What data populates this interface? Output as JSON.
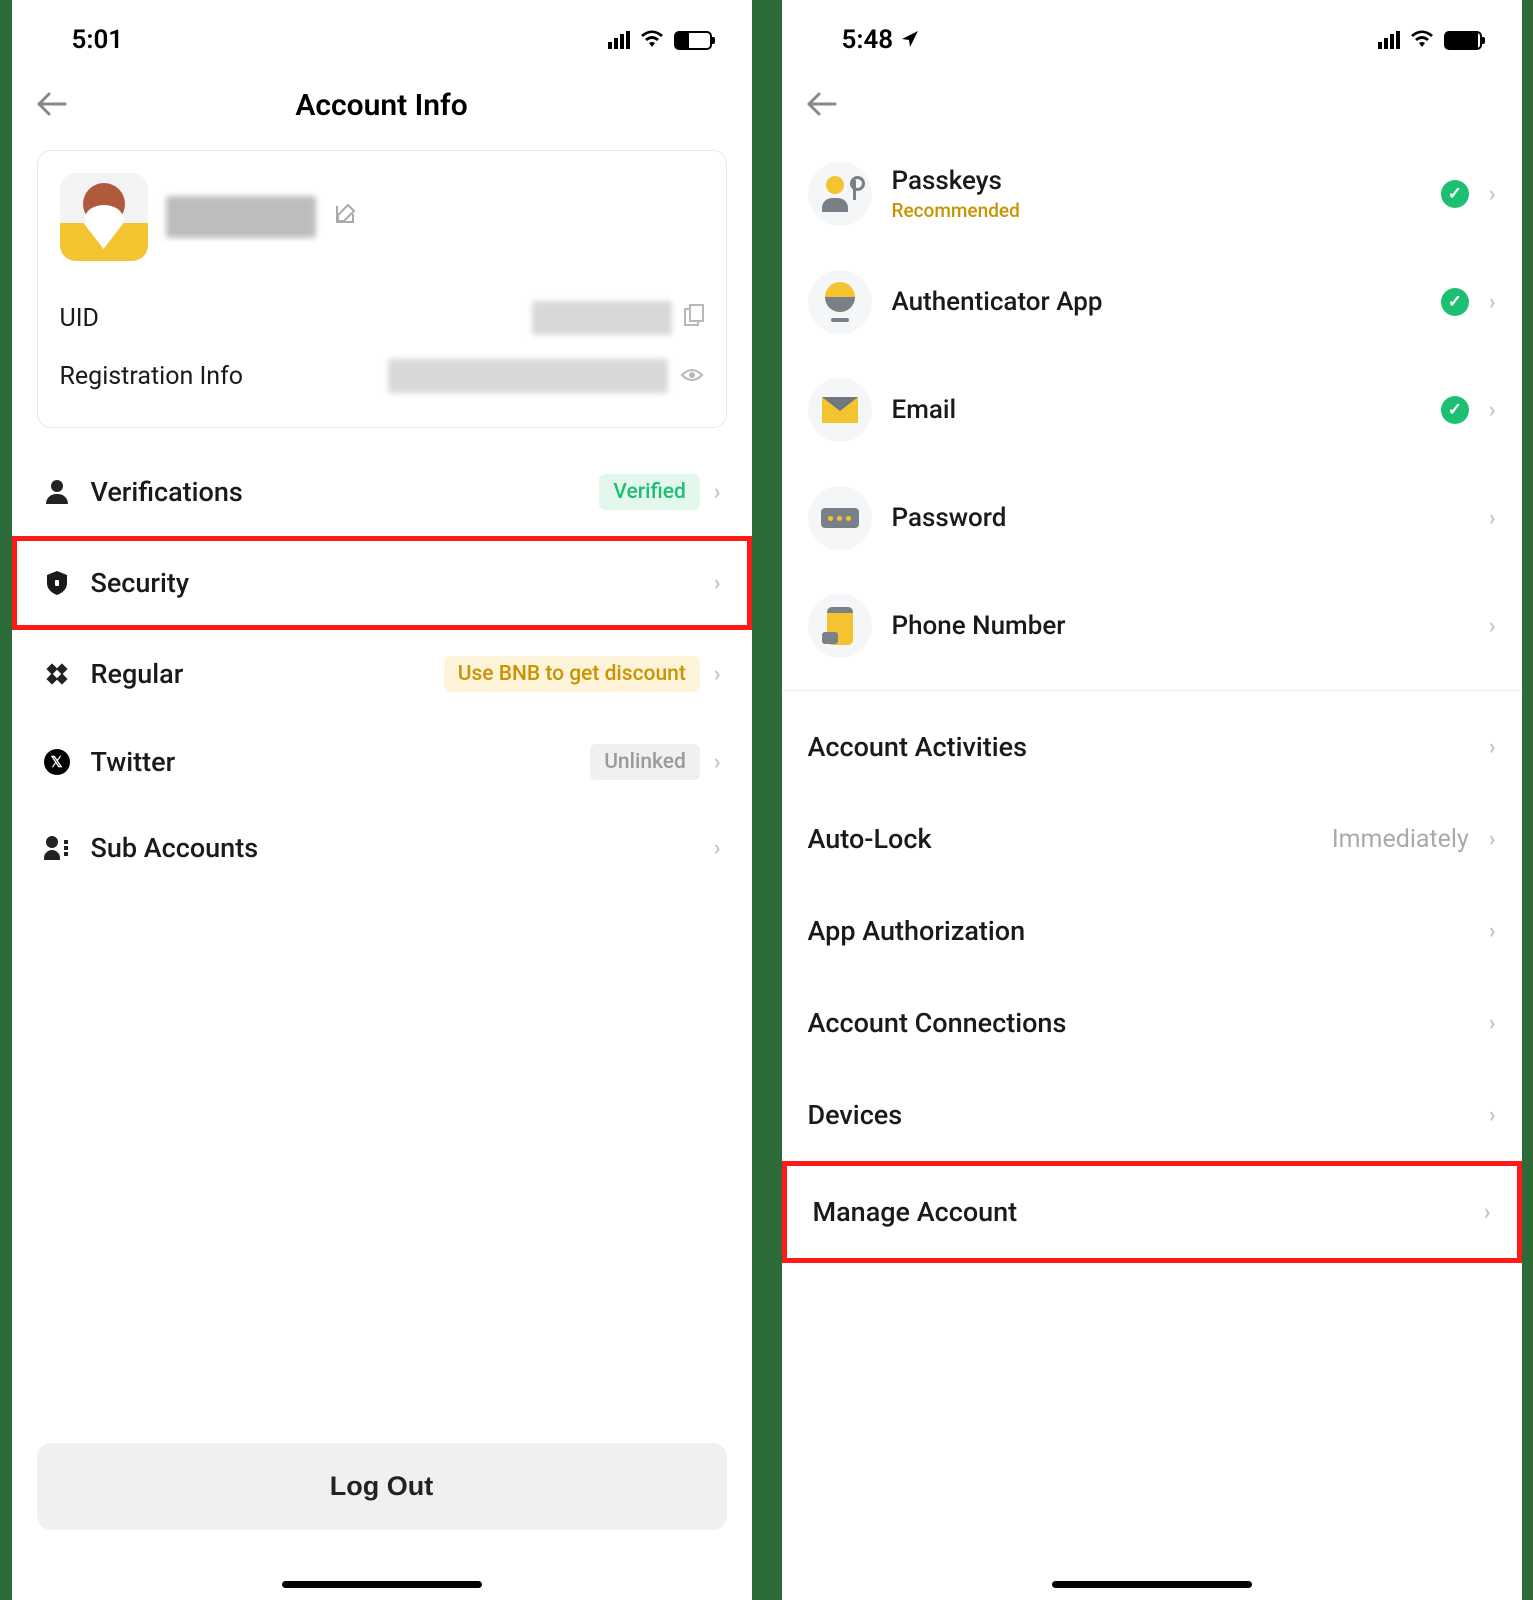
{
  "left": {
    "status": {
      "time": "5:01"
    },
    "header": {
      "title": "Account Info"
    },
    "profile": {
      "uid_label": "UID",
      "reg_label": "Registration Info"
    },
    "rows": {
      "verifications": {
        "label": "Verifications",
        "badge": "Verified"
      },
      "security": {
        "label": "Security"
      },
      "regular": {
        "label": "Regular",
        "badge": "Use BNB to get discount"
      },
      "twitter": {
        "label": "Twitter",
        "badge": "Unlinked"
      },
      "sub": {
        "label": "Sub Accounts"
      }
    },
    "logout": "Log Out"
  },
  "right": {
    "status": {
      "time": "5:48"
    },
    "security_rows": {
      "passkeys": {
        "label": "Passkeys",
        "sub": "Recommended"
      },
      "auth": {
        "label": "Authenticator App"
      },
      "email": {
        "label": "Email"
      },
      "password": {
        "label": "Password"
      },
      "phone": {
        "label": "Phone Number"
      }
    },
    "plain_rows": {
      "activities": "Account Activities",
      "autolock": {
        "label": "Auto-Lock",
        "value": "Immediately"
      },
      "appauth": "App Authorization",
      "connections": "Account Connections",
      "devices": "Devices",
      "manage": "Manage Account"
    }
  }
}
